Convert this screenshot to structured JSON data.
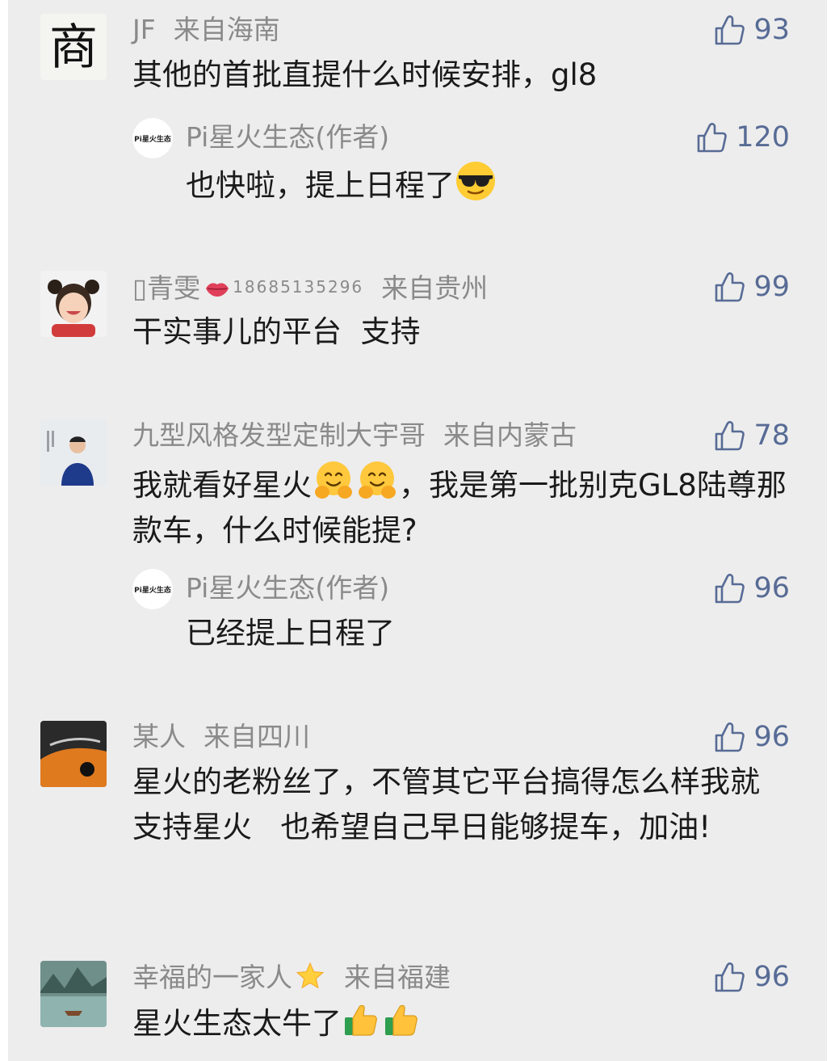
{
  "comments": [
    {
      "author": "JF",
      "location": "来自海南",
      "likes": "93",
      "text": "其他的首批直提什么时候安排，gl8",
      "avatar": {
        "glyph": "商"
      },
      "reply": {
        "author": "Pi星火生态(作者)",
        "likes": "120",
        "text": "也快啦，提上日程了",
        "emoji": "sunglasses-face"
      }
    },
    {
      "author": "▯青雯",
      "author_suffix": "18685135296",
      "location": "来自贵州",
      "likes": "99",
      "text": "干实事儿的平台  支持"
    },
    {
      "author": "九型风格发型定制大宇哥",
      "location": "来自内蒙古",
      "likes": "78",
      "text_a": "我就看好星火",
      "text_b": "，我是第一批别克GL8陆尊那款车，什么时候能提?",
      "reply": {
        "author": "Pi星火生态(作者)",
        "likes": "96",
        "text": "已经提上日程了"
      }
    },
    {
      "author": "某人",
      "location": "来自四川",
      "likes": "96",
      "text": "星火的老粉丝了，不管其它平台搞得怎么样我就支持星火   也希望自己早日能够提车，加油!"
    },
    {
      "author": "幸福的一家人",
      "location": "来自福建",
      "likes": "96",
      "text": "星火生态太牛了"
    }
  ],
  "author_avatar_text": "Pi星火生态",
  "colors": {
    "background": "#ededed",
    "name": "#8a8a8a",
    "like": "#576b95",
    "text": "#1a1a1a"
  }
}
